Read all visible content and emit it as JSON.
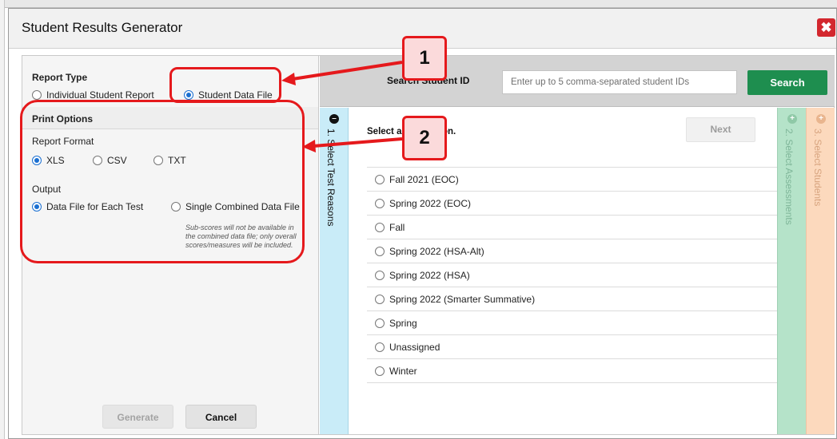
{
  "dialog": {
    "title": "Student Results Generator",
    "close_glyph": "✖"
  },
  "report_type": {
    "heading": "Report Type",
    "options": [
      {
        "label": "Individual Student Report",
        "selected": false
      },
      {
        "label": "Student Data File",
        "selected": true
      }
    ]
  },
  "print_options": {
    "heading": "Print Options",
    "report_format": {
      "heading": "Report Format",
      "options": [
        {
          "label": "XLS",
          "selected": true
        },
        {
          "label": "CSV",
          "selected": false
        },
        {
          "label": "TXT",
          "selected": false
        }
      ]
    },
    "output": {
      "heading": "Output",
      "options": [
        {
          "label": "Data File for Each Test",
          "selected": true
        },
        {
          "label": "Single Combined Data File",
          "selected": false
        }
      ],
      "note": "Sub-scores will not be available in the combined data file; only overall scores/measures will be included."
    }
  },
  "footer": {
    "generate_label": "Generate",
    "cancel_label": "Cancel"
  },
  "search": {
    "label": "Search Student ID",
    "placeholder": "Enter up to 5 comma-separated student IDs",
    "button_label": "Search"
  },
  "steps": [
    {
      "label": "1. Select Test Reasons",
      "icon": "minus-circle-icon",
      "dot": "–",
      "active": true
    },
    {
      "label": "2. Select Assessments",
      "icon": "plus-circle-icon",
      "dot": "+",
      "active": false
    },
    {
      "label": "3. Select Students",
      "icon": "plus-circle-icon",
      "dot": "+",
      "active": false
    }
  ],
  "test_reasons": {
    "title": "Select a test reason.",
    "next_label": "Next",
    "items": [
      "Fall 2021 (EOC)",
      "Spring 2022 (EOC)",
      "Fall",
      "Spring 2022 (HSA-Alt)",
      "Spring 2022 (HSA)",
      "Spring 2022 (Smarter Summative)",
      "Spring",
      "Unassigned",
      "Winter"
    ]
  },
  "callouts": [
    "1",
    "2"
  ],
  "colors": {
    "search_button": "#1e8e4f",
    "close_button": "#d3272e",
    "callout_border": "#e5191c",
    "step1_bg": "#c9ecf8",
    "step2_bg": "#b5e3c9",
    "step3_bg": "#fcd9bd",
    "radio_selected": "#1a6fd1"
  }
}
